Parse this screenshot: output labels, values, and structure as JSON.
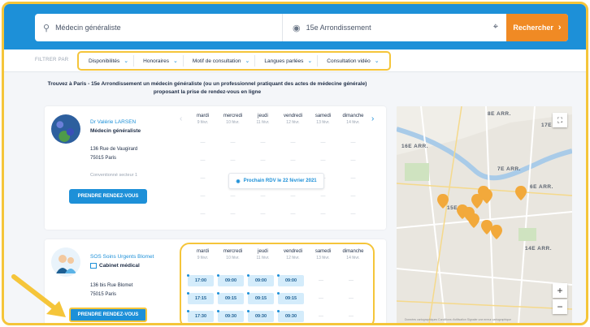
{
  "search": {
    "specialty_value": "Médecin généraliste",
    "location_value": "15e Arrondissement",
    "button_label": "Rechercher"
  },
  "filters": {
    "label": "FILTRER PAR",
    "items": [
      "Disponibilités",
      "Honoraires",
      "Motif de consultation",
      "Langues parlées",
      "Consultation vidéo"
    ]
  },
  "headline": "Trouvez à Paris - 15e Arrondissement un médecin généraliste (ou un professionnel pratiquant des actes de médecine générale) proposant la prise de rendez-vous en ligne",
  "days": [
    {
      "name": "mardi",
      "date": "9 févr."
    },
    {
      "name": "mercredi",
      "date": "10 févr."
    },
    {
      "name": "jeudi",
      "date": "11 févr."
    },
    {
      "name": "vendredi",
      "date": "12 févr."
    },
    {
      "name": "samedi",
      "date": "13 févr."
    },
    {
      "name": "dimanche",
      "date": "14 févr."
    }
  ],
  "card1": {
    "name": "Dr Valérie LARSEN",
    "type": "Médecin généraliste",
    "address_line1": "136 Rue de Vaugirard",
    "address_line2": "75015 Paris",
    "convention": "Conventionné secteur 1",
    "button_label": "PRENDRE RENDEZ-VOUS",
    "next_rdv": "Prochain RDV le 22 février 2021"
  },
  "card2": {
    "name": "SOS Soins Urgents Blomet",
    "type": "Cabinet médical",
    "address_line1": "136 bis Rue Blomet",
    "address_line2": "75015 Paris",
    "button_label": "PRENDRE RENDEZ-VOUS",
    "slots": [
      [
        "17:00",
        "09:00",
        "09:00",
        "09:00",
        "—",
        "—"
      ],
      [
        "17:15",
        "09:15",
        "09:15",
        "09:15",
        "—",
        "—"
      ],
      [
        "17:30",
        "09:30",
        "09:30",
        "09:30",
        "—",
        "—"
      ]
    ]
  },
  "map": {
    "labels": [
      "8E ARR.",
      "17E ARR.",
      "16E ARR.",
      "7E ARR.",
      "6E ARR.",
      "15E",
      "14E ARR."
    ],
    "footer": "Données cartographiques  Conditions d'utilisation  Signaler une erreur cartographique"
  },
  "colors": {
    "brand_blue": "#1d90d8",
    "accent_orange": "#f08a24",
    "highlight_yellow": "#f5c53a"
  }
}
